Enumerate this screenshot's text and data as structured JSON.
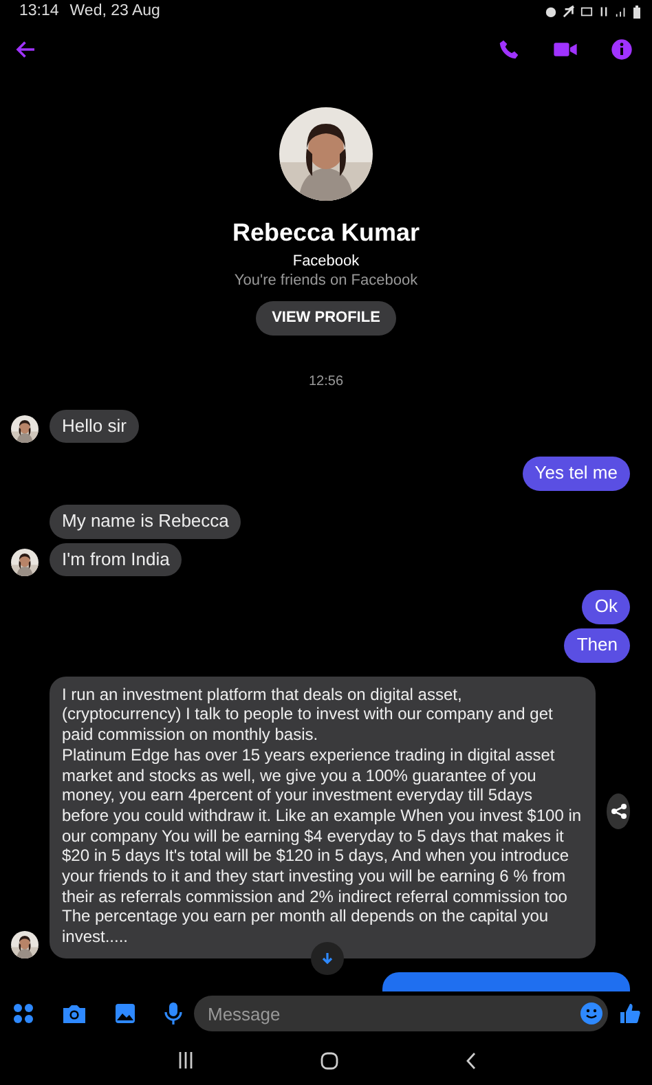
{
  "status_bar": {
    "time": "13:14",
    "date": "Wed, 23 Aug"
  },
  "profile": {
    "name": "Rebecca Kumar",
    "source": "Facebook",
    "relation": "You're friends on Facebook",
    "button": "VIEW PROFILE"
  },
  "timestamp": "12:56",
  "messages": [
    {
      "kind": "incoming",
      "text": "Hello sir",
      "avatar": true
    },
    {
      "kind": "outgoing",
      "text": "Yes tel me"
    },
    {
      "kind": "incoming",
      "text": "My name is Rebecca",
      "avatar": false
    },
    {
      "kind": "incoming",
      "text": "I'm from India",
      "avatar": true
    },
    {
      "kind": "outgoing",
      "text": "Ok"
    },
    {
      "kind": "outgoing",
      "text": "Then"
    },
    {
      "kind": "incoming",
      "text": "I run an investment platform that deals on digital asset, (cryptocurrency) I talk to people to invest with our company and get paid commission on monthly basis.\nPlatinum Edge has over 15 years experience trading in digital asset market and stocks as well, we give you a 100% guarantee of you money, you earn 4percent of your investment everyday till 5days before you could withdraw it. Like an example When you invest $100 in our company You will be earning $4 everyday to 5 days that makes it $20 in 5 days It's total will be $120 in 5 days, And when you introduce your friends to it and they start investing you will be earning 6 % from their as referrals commission and 2% indirect referral commission too\nThe percentage you earn per month all depends on the capital you invest.....",
      "avatar": true,
      "share": true
    },
    {
      "kind": "clipped"
    }
  ],
  "composer": {
    "placeholder": "Message"
  }
}
